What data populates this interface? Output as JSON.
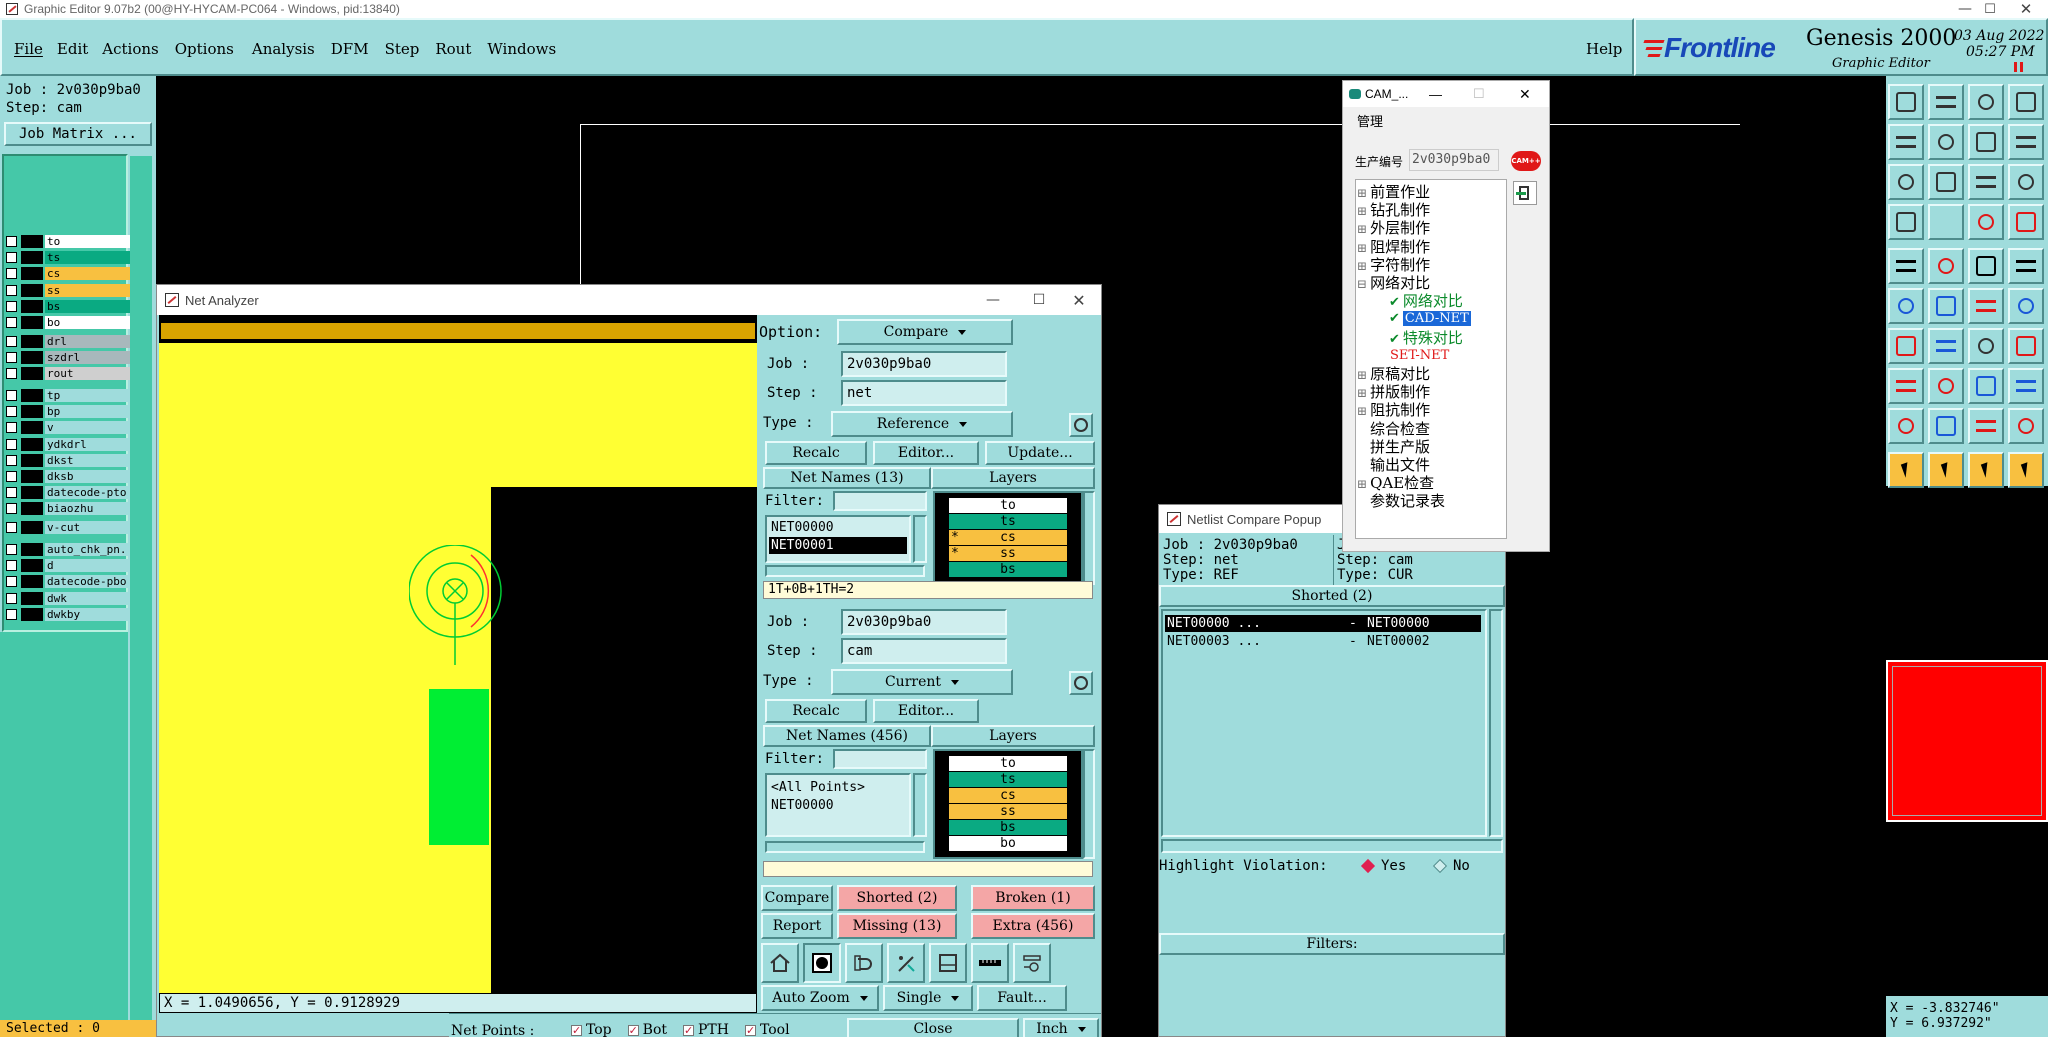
{
  "window_title": "Graphic Editor 9.07b2 (00@HY-HYCAM-PC064 - Windows, pid:13840)",
  "menu": {
    "items": [
      "File",
      "Edit",
      "Actions",
      "Options",
      "Analysis",
      "DFM",
      "Step",
      "Rout",
      "Windows"
    ],
    "help": "Help"
  },
  "brand": {
    "logo": "Frontline",
    "product": "Genesis 2000",
    "subtitle": "Graphic Editor",
    "date": "03 Aug 2022",
    "time": "05:27 PM"
  },
  "left_panel": {
    "job": "Job : 2v030p9ba0",
    "step": "Step: cam",
    "job_matrix": "Job Matrix ...",
    "groups": [
      [
        {
          "name": "to",
          "color": "#ffffff"
        },
        {
          "name": "ts",
          "color": "#0aaa82"
        },
        {
          "name": "cs",
          "color": "#f8c040"
        },
        {
          "name": "ss",
          "color": "#f8c040"
        },
        {
          "name": "bs",
          "color": "#0aaa82"
        },
        {
          "name": "bo",
          "color": "#ffffff"
        }
      ],
      [
        {
          "name": "drl",
          "color": "#a8b8bc"
        },
        {
          "name": "szdrl",
          "color": "#a8b8bc"
        },
        {
          "name": "rout",
          "color": "#cfcfcf"
        }
      ],
      [
        {
          "name": "tp",
          "color": "#9fdcdc"
        },
        {
          "name": "bp",
          "color": "#9fdcdc"
        },
        {
          "name": "v",
          "color": "#9fdcdc"
        },
        {
          "name": "ydkdrl",
          "color": "#9fdcdc"
        },
        {
          "name": "dkst",
          "color": "#9fdcdc"
        },
        {
          "name": "dksb",
          "color": "#9fdcdc"
        },
        {
          "name": "datecode-pto",
          "color": "#9fdcdc"
        },
        {
          "name": "biaozhu",
          "color": "#9fdcdc"
        }
      ],
      [
        {
          "name": "v-cut",
          "color": "#9fdcdc"
        }
      ],
      [
        {
          "name": "auto_chk_pn.",
          "color": "#9fdcdc"
        },
        {
          "name": "d",
          "color": "#9fdcdc"
        },
        {
          "name": "datecode-pbo",
          "color": "#9fdcdc"
        },
        {
          "name": "dwk",
          "color": "#9fdcdc"
        },
        {
          "name": "dwkby",
          "color": "#9fdcdc"
        }
      ]
    ],
    "selected": "Selected : 0"
  },
  "net_analyzer": {
    "title": "Net Analyzer",
    "coords": "X = 1.0490656, Y = 0.9128929",
    "option_label": "Option:",
    "option_value": "Compare",
    "ref": {
      "job_label": "Job :",
      "job": "2v030p9ba0",
      "step_label": "Step :",
      "step": "net",
      "type_label": "Type :",
      "type": "Reference",
      "recalc": "Recalc",
      "editor": "Editor...",
      "update": "Update...",
      "net_names": "Net Names (13)",
      "layers": "Layers",
      "filter_label": "Filter:",
      "nets": [
        "NET00000",
        "NET00001"
      ],
      "layer_list": [
        {
          "name": "to",
          "mark": "",
          "color": "#ffffff"
        },
        {
          "name": "ts",
          "mark": "",
          "color": "#0aaa82"
        },
        {
          "name": "cs",
          "mark": "*",
          "color": "#f8c040"
        },
        {
          "name": "ss",
          "mark": "*",
          "color": "#f8c040"
        },
        {
          "name": "bs",
          "mark": "",
          "color": "#0aaa82"
        }
      ],
      "status": "1T+0B+1TH=2"
    },
    "cur": {
      "job_label": "Job :",
      "job": "2v030p9ba0",
      "step_label": "Step :",
      "step": "cam",
      "type_label": "Type :",
      "type": "Current",
      "recalc": "Recalc",
      "editor": "Editor...",
      "net_names": "Net Names (456)",
      "layers": "Layers",
      "filter_label": "Filter:",
      "nets": [
        "<All Points>",
        "NET00000"
      ],
      "layer_list": [
        {
          "name": "to",
          "mark": "",
          "color": "#ffffff"
        },
        {
          "name": "ts",
          "mark": "",
          "color": "#0aaa82"
        },
        {
          "name": "cs",
          "mark": "",
          "color": "#f8c040"
        },
        {
          "name": "ss",
          "mark": "",
          "color": "#f8c040"
        },
        {
          "name": "bs",
          "mark": "",
          "color": "#0aaa82"
        },
        {
          "name": "bo",
          "mark": "",
          "color": "#ffffff"
        }
      ]
    },
    "compare": "Compare",
    "shorted": "Shorted (2)",
    "broken": "Broken (1)",
    "report": "Report",
    "missing": "Missing (13)",
    "extra": "Extra (456)",
    "auto_zoom": "Auto Zoom",
    "single": "Single",
    "fault": "Fault...",
    "net_points_label": "Net Points :",
    "net_points": [
      "Top",
      "Bot",
      "PTH",
      "Tool"
    ],
    "close": "Close",
    "units": "Inch"
  },
  "netlist_popup": {
    "title": "Netlist Compare Popup",
    "left_job": "Job : 2v030p9ba0",
    "left_step": "Step: net",
    "left_type": "Type: REF",
    "right_job": "J",
    "right_step": "Step: cam",
    "right_type": "Type: CUR",
    "section": "Shorted (2)",
    "rows": [
      {
        "left": "NET00000 ...",
        "sep": "-",
        "right": "NET00000"
      },
      {
        "left": "NET00003 ...",
        "sep": "-",
        "right": "NET00002"
      }
    ],
    "highlight_label": "Highlight Violation:",
    "yes": "Yes",
    "no": "No",
    "filters": "Filters:"
  },
  "cam_window": {
    "title": "CAM_...",
    "menu": "管理",
    "prod_label": "生产编号",
    "prod_value": "2v030p9ba0",
    "badge": "CAM++",
    "tree": [
      {
        "label": "前置作业",
        "type": "node"
      },
      {
        "label": "钻孔制作",
        "type": "node"
      },
      {
        "label": "外层制作",
        "type": "node"
      },
      {
        "label": "阻焊制作",
        "type": "node"
      },
      {
        "label": "字符制作",
        "type": "node"
      },
      {
        "label": "网络对比",
        "type": "open"
      },
      {
        "label": "网络对比",
        "type": "check"
      },
      {
        "label": "CAD-NET",
        "type": "check-sel"
      },
      {
        "label": "特殊对比",
        "type": "check"
      },
      {
        "label": "SET-NET",
        "type": "red"
      },
      {
        "label": "原稿对比",
        "type": "node"
      },
      {
        "label": "拼版制作",
        "type": "node"
      },
      {
        "label": "阻抗制作",
        "type": "node"
      },
      {
        "label": "综合检查",
        "type": "leaf"
      },
      {
        "label": "拼生产版",
        "type": "leaf"
      },
      {
        "label": "输出文件",
        "type": "leaf"
      },
      {
        "label": "QAE检查",
        "type": "node"
      },
      {
        "label": "参数记录表",
        "type": "leaf"
      }
    ]
  },
  "right_panel": {
    "x_coord": "X = -3.832746\"",
    "y_coord": "Y = 6.937292\""
  },
  "colors": {
    "teal": "#9fdcdc",
    "yellow": "#ffff33",
    "green": "#00ee33",
    "red": "#ff0000",
    "gold": "#d9a400",
    "pink": "#f4a6a6"
  }
}
